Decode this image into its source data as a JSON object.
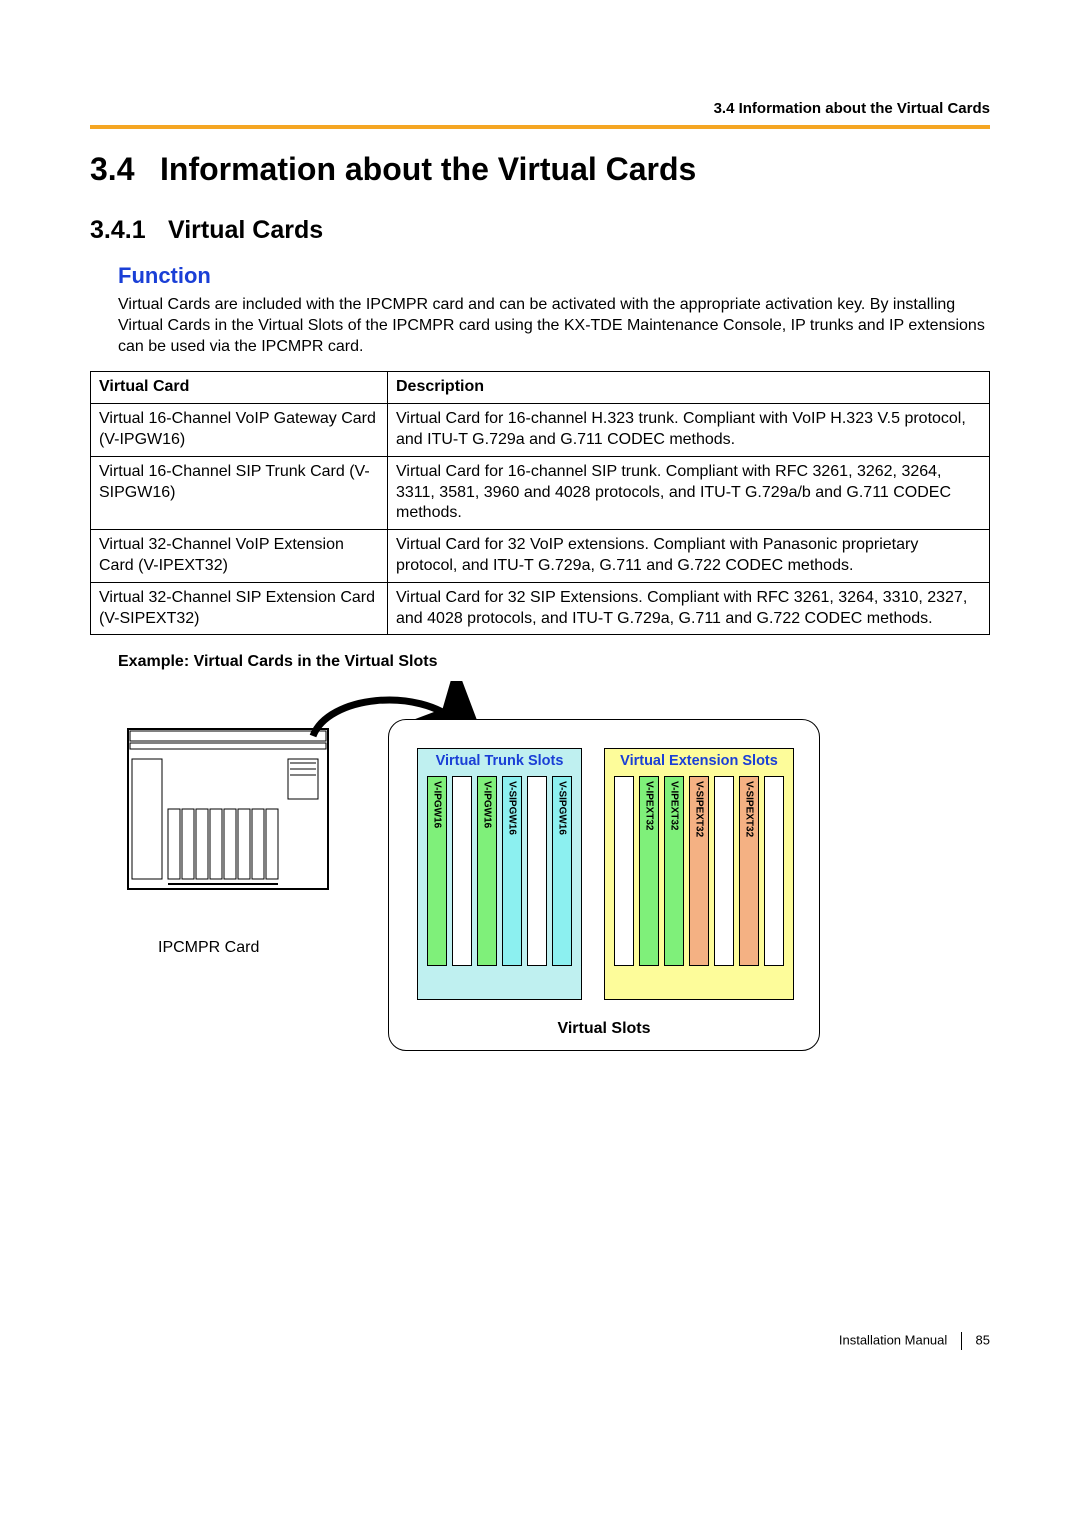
{
  "header": {
    "breadcrumb": "3.4 Information about the Virtual Cards"
  },
  "section": {
    "number": "3.4",
    "title": "Information about the Virtual Cards"
  },
  "subsection": {
    "number": "3.4.1",
    "title": "Virtual Cards"
  },
  "function": {
    "heading": "Function",
    "intro": "Virtual Cards are included with the IPCMPR card and can be activated with the appropriate activation key. By installing Virtual Cards in the Virtual Slots of the IPCMPR card using the KX-TDE Maintenance Console, IP trunks and IP extensions can be used via the IPCMPR card."
  },
  "table": {
    "headers": {
      "col1": "Virtual Card",
      "col2": "Description"
    },
    "rows": [
      {
        "card": "Virtual 16-Channel VoIP Gateway Card (V-IPGW16)",
        "desc": "Virtual Card for 16-channel H.323 trunk. Compliant with VoIP H.323 V.5 protocol, and ITU-T G.729a and G.711 CODEC methods."
      },
      {
        "card": "Virtual 16-Channel SIP Trunk Card (V-SIPGW16)",
        "desc": "Virtual Card for 16-channel SIP trunk. Compliant with RFC 3261, 3262, 3264, 3311, 3581, 3960 and 4028 protocols, and ITU-T G.729a/b and G.711 CODEC methods."
      },
      {
        "card": "Virtual 32-Channel VoIP Extension Card (V-IPEXT32)",
        "desc": "Virtual Card for 32 VoIP extensions. Compliant with Panasonic proprietary protocol, and ITU-T G.729a, G.711 and G.722 CODEC methods."
      },
      {
        "card": "Virtual 32-Channel SIP Extension Card (V-SIPEXT32)",
        "desc": "Virtual Card for 32 SIP Extensions. Compliant with RFC 3261, 3264, 3310, 2327, and 4028 protocols, and ITU-T G.729a, G.711 and G.722 CODEC methods."
      }
    ]
  },
  "example": {
    "title": "Example: Virtual Cards in the Virtual Slots"
  },
  "diagram": {
    "ipcmpr_label": "IPCMPR Card",
    "virtual_slots_label": "Virtual Slots",
    "trunk_group_title": "Virtual Trunk Slots",
    "ext_group_title": "Virtual Extension Slots",
    "trunk_cards": [
      "V-IPGW16",
      "V-IPGW16",
      "V-SIPGW16",
      "V-SIPGW16"
    ],
    "ext_cards": [
      "V-IPEXT32",
      "V-IPEXT32",
      "V-SIPEXT32",
      "V-SIPEXT32"
    ]
  },
  "footer": {
    "manual": "Installation Manual",
    "page": "85"
  }
}
